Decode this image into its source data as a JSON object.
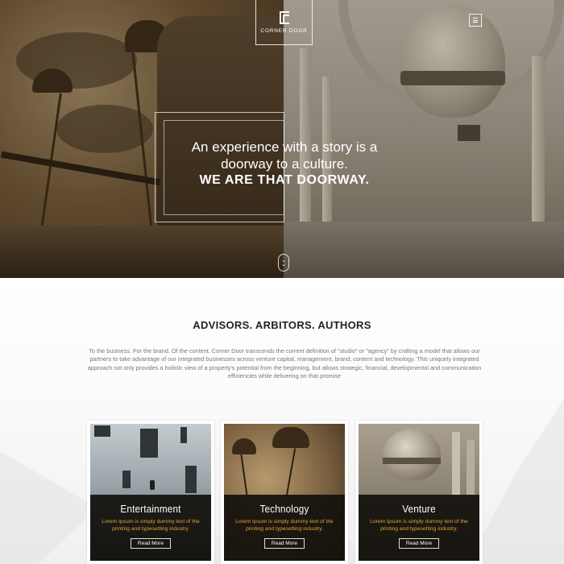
{
  "brand": {
    "name": "Corner Door"
  },
  "nav": {
    "menu_icon": "hamburger-icon"
  },
  "hero": {
    "line1": "An experience with a story is a",
    "line2": "doorway to a culture.",
    "tagline": "WE ARE THAT DOORWAY.",
    "scroll_icon": "double-chevron-down-icon"
  },
  "about": {
    "title": "ADVISORS. ARBITORS. AUTHORS",
    "body": "To the business. For the brand. Of the content. Corner Door transcends the current definition of \"studio\" or \"agency\" by crafting a model that allows our partners to take advantage of our integrated businesses across venture capital, management, brand, content and technology.  This uniquely integrated approach not only provides  a holistic view of a property's potential from the beginning, but allows strategic, financial, developmental and communication efficiencies while delivering on that promise"
  },
  "cards": [
    {
      "title": "Entertainment",
      "desc": "Lorem Ipsum is simply dummy text of the printing and typesetting industry.",
      "button": "Read More"
    },
    {
      "title": "Technology",
      "desc": "Lorem Ipsum is simply dummy text of the printing and typesetting industry.",
      "button": "Read More"
    },
    {
      "title": "Venture",
      "desc": "Lorem Ipsum is simply dummy text of the printing and typesetting industry.",
      "button": "Read More"
    }
  ],
  "colors": {
    "accent": "#e0a531",
    "card_panel": "#12100c",
    "title": "#222222",
    "body_text": "#777777"
  }
}
